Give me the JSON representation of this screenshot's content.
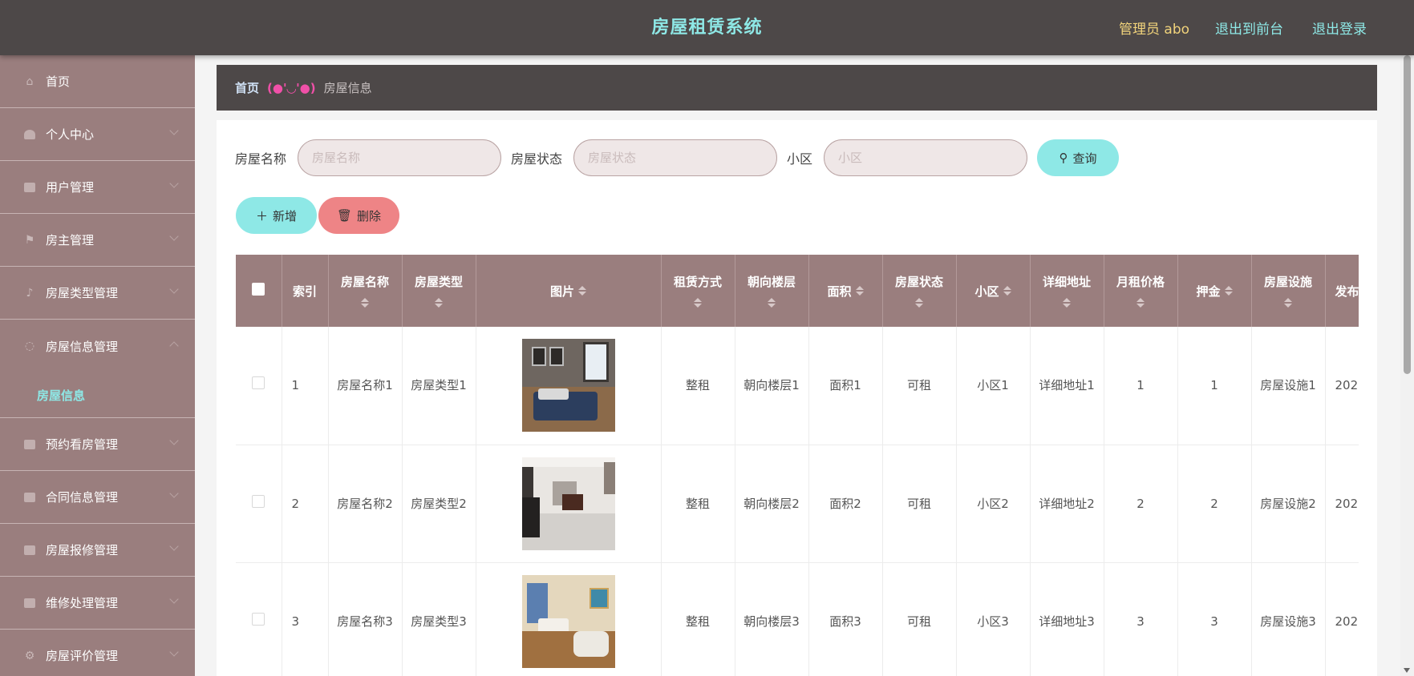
{
  "header": {
    "title": "房屋租赁系统",
    "user": "管理员 abo",
    "back_to_front": "退出到前台",
    "logout": "退出登录"
  },
  "sidebar": {
    "items": [
      {
        "label": "首页",
        "icon": "home-icon"
      },
      {
        "label": "个人中心",
        "icon": "user-icon"
      },
      {
        "label": "用户管理",
        "icon": "briefcase-icon"
      },
      {
        "label": "房主管理",
        "icon": "flag-icon"
      },
      {
        "label": "房屋类型管理",
        "icon": "bell-icon"
      },
      {
        "label": "房屋信息管理",
        "icon": "power-icon"
      },
      {
        "label": "预约看房管理",
        "icon": "clipboard-icon"
      },
      {
        "label": "合同信息管理",
        "icon": "chat-icon"
      },
      {
        "label": "房屋报修管理",
        "icon": "clipboard-icon"
      },
      {
        "label": "维修处理管理",
        "icon": "picture-icon"
      },
      {
        "label": "房屋评价管理",
        "icon": "gear-icon"
      }
    ],
    "active_sub": "房屋信息"
  },
  "breadcrumb": {
    "home": "首页",
    "separator": "(●'◡'●)",
    "current": "房屋信息"
  },
  "search": {
    "name_label": "房屋名称",
    "name_placeholder": "房屋名称",
    "status_label": "房屋状态",
    "status_placeholder": "房屋状态",
    "community_label": "小区",
    "community_placeholder": "小区",
    "button": "查询"
  },
  "actions": {
    "add": "新增",
    "delete": "删除"
  },
  "table": {
    "headers": [
      "索引",
      "房屋名称",
      "房屋类型",
      "图片",
      "租赁方式",
      "朝向楼层",
      "面积",
      "房屋状态",
      "小区",
      "详细地址",
      "月租价格",
      "押金",
      "房屋设施",
      "发布"
    ],
    "rows": [
      {
        "index": "1",
        "name": "房屋名称1",
        "type": "房屋类型1",
        "rent_mode": "整租",
        "floor": "朝向楼层1",
        "area": "面积1",
        "status": "可租",
        "community": "小区1",
        "address": "详细地址1",
        "price": "1",
        "deposit": "1",
        "facility": "房屋设施1",
        "published": "202"
      },
      {
        "index": "2",
        "name": "房屋名称2",
        "type": "房屋类型2",
        "rent_mode": "整租",
        "floor": "朝向楼层2",
        "area": "面积2",
        "status": "可租",
        "community": "小区2",
        "address": "详细地址2",
        "price": "2",
        "deposit": "2",
        "facility": "房屋设施2",
        "published": "202"
      },
      {
        "index": "3",
        "name": "房屋名称3",
        "type": "房屋类型3",
        "rent_mode": "整租",
        "floor": "朝向楼层3",
        "area": "面积3",
        "status": "可租",
        "community": "小区3",
        "address": "详细地址3",
        "price": "3",
        "deposit": "3",
        "facility": "房屋设施3",
        "published": "202"
      }
    ]
  },
  "colors": {
    "header_bg": "#4d4848",
    "sidebar_bg": "#9a7e7e",
    "accent": "#8ee8e6",
    "danger": "#ee8486",
    "user_text": "#f1d37b"
  }
}
